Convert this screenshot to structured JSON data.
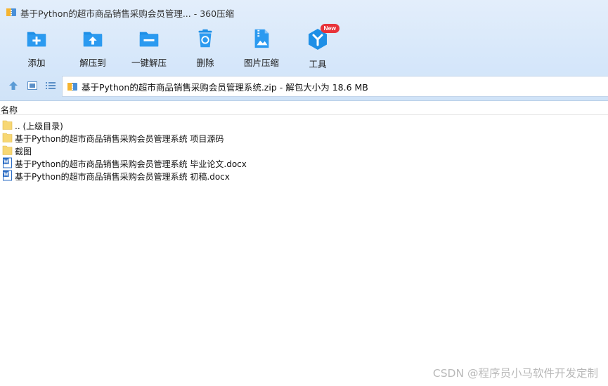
{
  "window": {
    "title": "基于Python的超市商品销售采购会员管理... - 360压缩"
  },
  "toolbar": {
    "items": [
      {
        "id": "add",
        "label": "添加",
        "icon": "folder-add-icon"
      },
      {
        "id": "extract",
        "label": "解压到",
        "icon": "folder-extract-icon"
      },
      {
        "id": "one-click-extract",
        "label": "一键解压",
        "icon": "folder-oneclick-icon"
      },
      {
        "id": "delete",
        "label": "删除",
        "icon": "recycle-bin-icon"
      },
      {
        "id": "image-compress",
        "label": "图片压缩",
        "icon": "image-compress-icon"
      },
      {
        "id": "tools",
        "label": "工具",
        "icon": "tools-icon",
        "badge": "New"
      }
    ]
  },
  "address": {
    "path": "基于Python的超市商品销售采购会员管理系统.zip - 解包大小为 18.6 MB"
  },
  "list": {
    "column_name": "名称",
    "rows": [
      {
        "name": ".. (上级目录)",
        "type": "folder"
      },
      {
        "name": "基于Python的超市商品销售采购会员管理系统 项目源码",
        "type": "folder"
      },
      {
        "name": "截图",
        "type": "folder"
      },
      {
        "name": "基于Python的超市商品销售采购会员管理系统 毕业论文.docx",
        "type": "word"
      },
      {
        "name": "基于Python的超市商品销售采购会员管理系统 初稿.docx",
        "type": "word"
      }
    ]
  },
  "watermark": "CSDN @程序员小马软件开发定制",
  "colors": {
    "accent": "#1e8fe6",
    "badge": "#e8333a",
    "folder": "#f7d774"
  }
}
